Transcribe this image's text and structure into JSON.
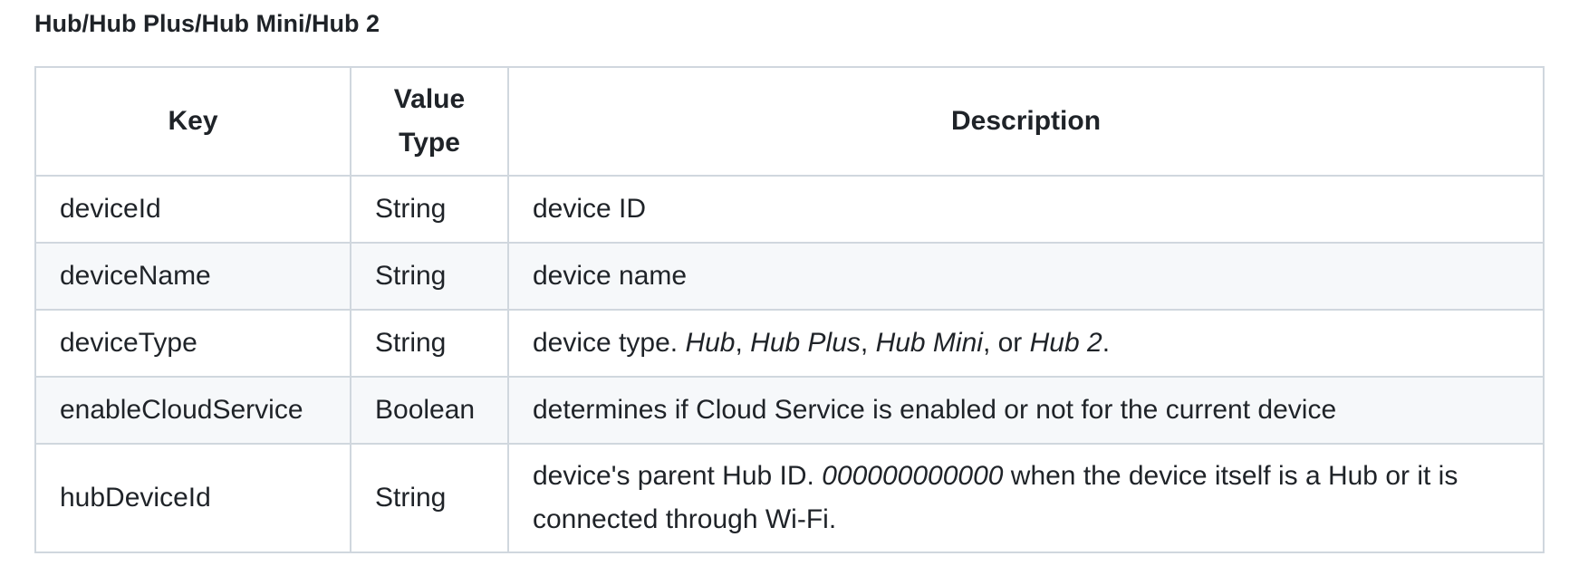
{
  "section": {
    "title": "Hub/Hub Plus/Hub Mini/Hub 2"
  },
  "table": {
    "headers": {
      "key": "Key",
      "value_type_line1": "Value",
      "value_type_line2": "Type",
      "description": "Description"
    },
    "rows": [
      {
        "key": "deviceId",
        "type": "String",
        "desc": {
          "text": "device ID"
        }
      },
      {
        "key": "deviceName",
        "type": "String",
        "desc": {
          "text": "device name"
        }
      },
      {
        "key": "deviceType",
        "type": "String",
        "desc": {
          "prefix": "device type. ",
          "opt1": "Hub",
          "sep1": ", ",
          "opt2": "Hub Plus",
          "sep2": ", ",
          "opt3": "Hub Mini",
          "sep3": ", or ",
          "opt4": "Hub 2",
          "suffix": "."
        }
      },
      {
        "key": "enableCloudService",
        "type": "Boolean",
        "desc": {
          "text": "determines if Cloud Service is enabled or not for the current device"
        }
      },
      {
        "key": "hubDeviceId",
        "type": "String",
        "desc": {
          "prefix": "device's parent Hub ID. ",
          "code": "000000000000",
          "suffix": " when the device itself is a Hub or it is connected through Wi-Fi."
        }
      }
    ]
  }
}
